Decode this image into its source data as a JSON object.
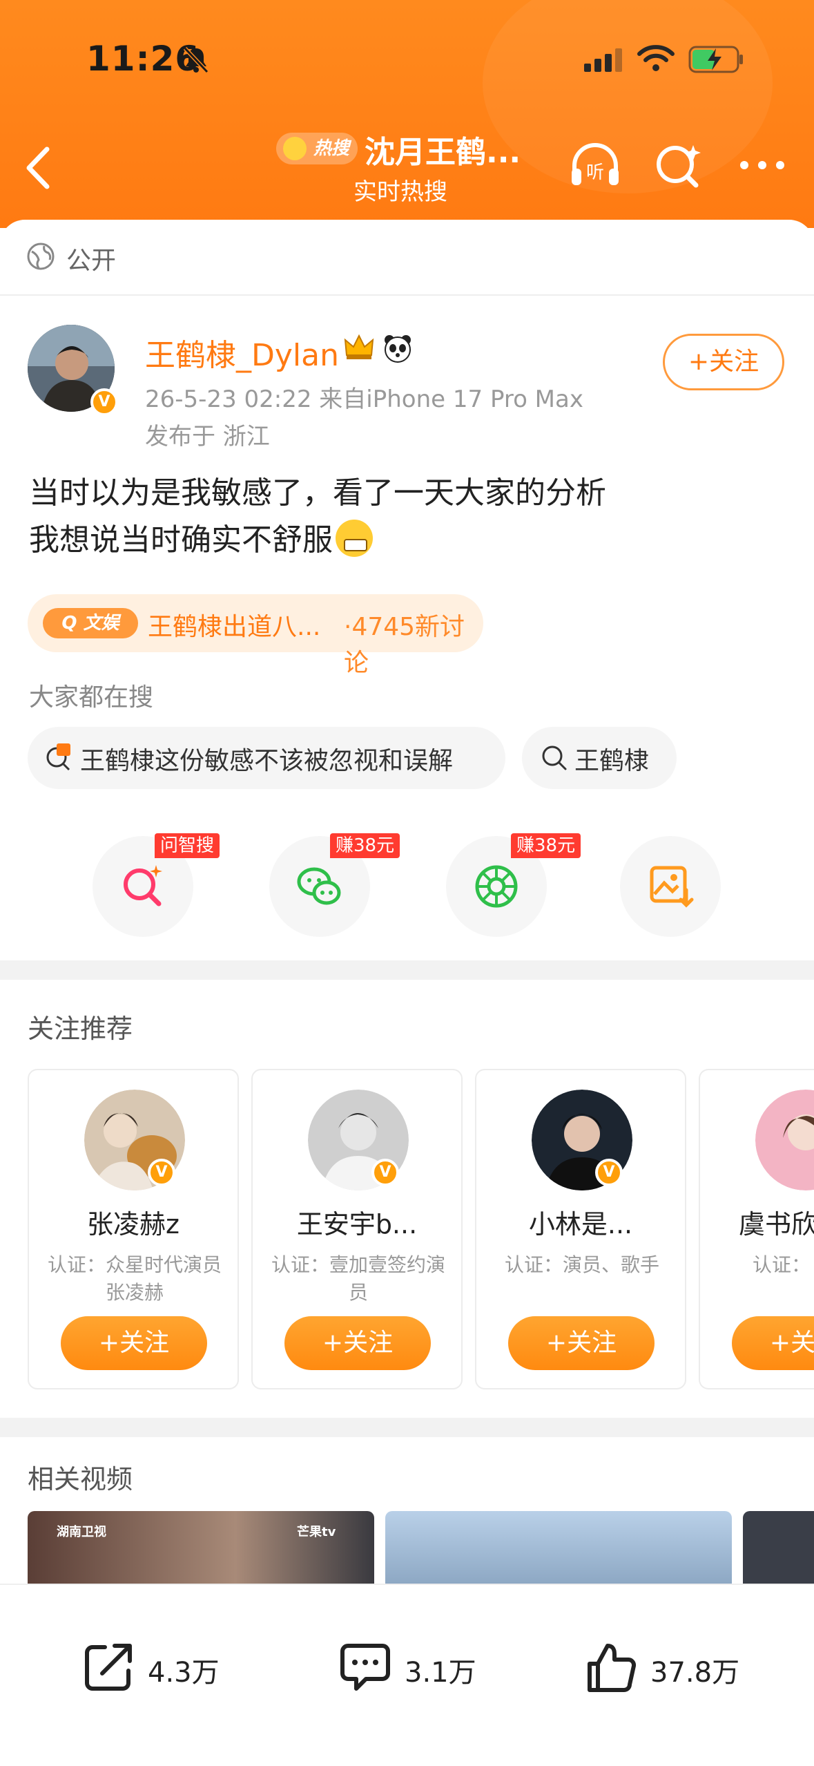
{
  "status_bar": {
    "time": "11:26"
  },
  "header": {
    "hot_tag": "热搜",
    "title": "沈月王鹤...",
    "subtitle": "实时热搜",
    "listen_label": "听"
  },
  "visibility": {
    "label": "公开"
  },
  "post": {
    "author": "王鹤棣_Dylan",
    "date_device": "26-5-23 02:22  来自iPhone 17 Pro Max",
    "location": "发布于 浙江",
    "follow_label": "+关注",
    "text_line1": "当时以为是我敏感了，看了一天大家的分析",
    "text_line2": "我想说当时确实不舒服",
    "topic_tag": "文娱",
    "topic_name": "王鹤棣出道八...",
    "topic_count": "·4745新讨论"
  },
  "search": {
    "label": "大家都在搜",
    "items": [
      {
        "icon": "hot-search-icon",
        "text": "王鹤棣这份敏感不该被忽视和误解"
      },
      {
        "icon": "search-icon",
        "text": "王鹤棣"
      }
    ]
  },
  "share_actions": [
    {
      "icon": "ai-search-icon",
      "tag": "问智搜"
    },
    {
      "icon": "wechat-icon",
      "tag": "赚38元"
    },
    {
      "icon": "moments-icon",
      "tag": "赚38元"
    },
    {
      "icon": "save-image-icon",
      "tag": ""
    }
  ],
  "recommend": {
    "title": "关注推荐",
    "cards": [
      {
        "name": "张凌赫z",
        "desc": "认证：众星时代演员 张凌赫",
        "follow": "+关注"
      },
      {
        "name": "王安宇b...",
        "desc": "认证：壹加壹签约演员",
        "follow": "+关注"
      },
      {
        "name": "小林是...",
        "desc": "认证：演员、歌手",
        "follow": "+关注"
      },
      {
        "name": "虞书欣",
        "desc": "认证：",
        "follow": "+关注"
      }
    ]
  },
  "videos": {
    "title": "相关视频",
    "logos": [
      "湖南卫视",
      "芒果tv"
    ]
  },
  "bottom_bar": {
    "share_count": "4.3万",
    "comment_count": "3.1万",
    "like_count": "37.8万"
  },
  "colors": {
    "brand": "#ff7a12",
    "accent_light": "#fff0e0",
    "tag_red": "#ff3b30"
  }
}
